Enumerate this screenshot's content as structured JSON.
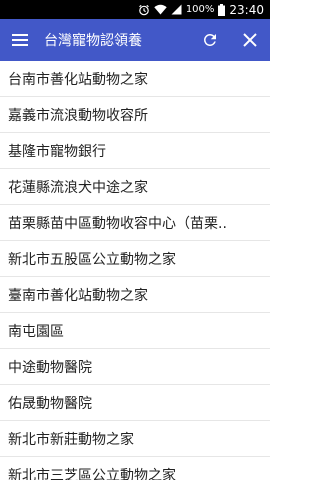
{
  "status_bar": {
    "battery_percent": "100%",
    "time": "23:40",
    "icons": [
      "alarm-icon",
      "wifi-icon",
      "signal-icon",
      "battery-icon"
    ]
  },
  "app_bar": {
    "title": "台灣寵物認領養",
    "background": "#4258c8",
    "icons": [
      "menu-icon",
      "refresh-icon",
      "close-icon"
    ]
  },
  "list": {
    "items": [
      {
        "label": "台南市善化站動物之家"
      },
      {
        "label": "嘉義市流浪動物收容所"
      },
      {
        "label": "基隆市寵物銀行"
      },
      {
        "label": "花蓮縣流浪犬中途之家"
      },
      {
        "label": "苗栗縣苗中區動物收容中心（苗栗.."
      },
      {
        "label": "新北市五股區公立動物之家"
      },
      {
        "label": "臺南市善化站動物之家"
      },
      {
        "label": "南屯園區"
      },
      {
        "label": "中途動物醫院"
      },
      {
        "label": "佑晟動物醫院"
      },
      {
        "label": "新北市新莊動物之家"
      },
      {
        "label": "新北市三芝區公立動物之家"
      }
    ]
  }
}
